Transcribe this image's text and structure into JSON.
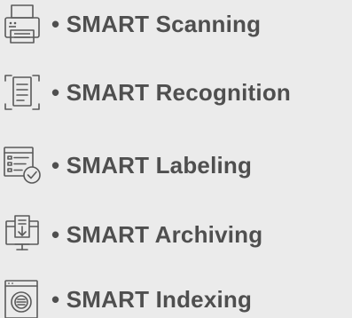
{
  "items": [
    {
      "icon": "printer-scanner-icon",
      "label": "• SMART Scanning"
    },
    {
      "icon": "document-scan-frame-icon",
      "label": "• SMART Recognition"
    },
    {
      "icon": "checklist-document-icon",
      "label": "• SMART Labeling"
    },
    {
      "icon": "archive-download-icon",
      "label": "• SMART Archiving"
    },
    {
      "icon": "search-document-icon",
      "label": "• SMART Indexing"
    }
  ],
  "colors": {
    "background": "#ebebeb",
    "text": "#4f4f4f",
    "icon": "#5a5a5a"
  }
}
